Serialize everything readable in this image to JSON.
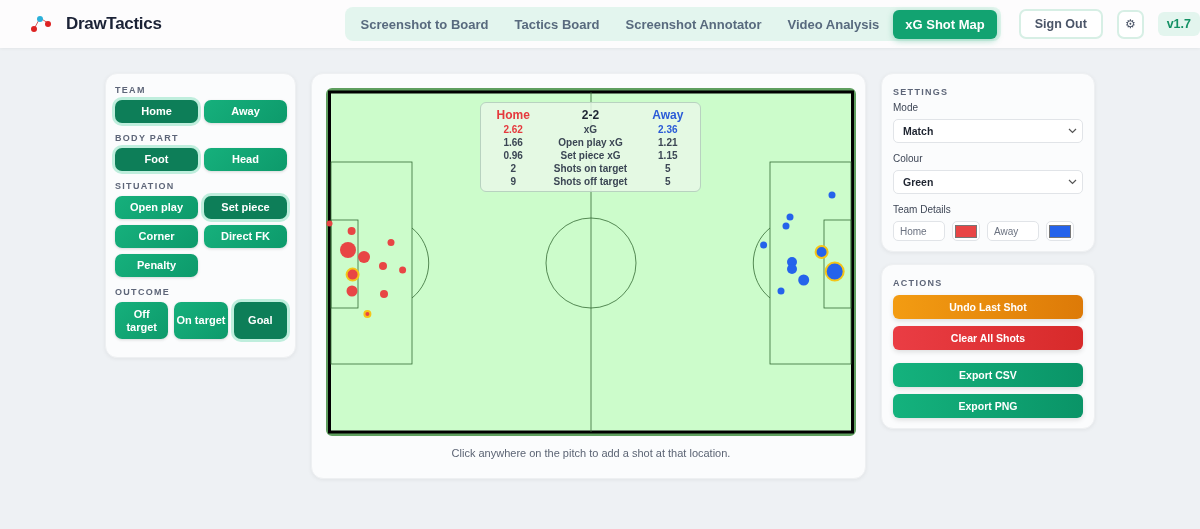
{
  "header": {
    "brand": "DrawTactics",
    "nav": [
      {
        "label": "Screenshot to Board",
        "selected": false
      },
      {
        "label": "Tactics Board",
        "selected": false
      },
      {
        "label": "Screenshot Annotator",
        "selected": false
      },
      {
        "label": "Video Analysis",
        "selected": false
      },
      {
        "label": "xG Shot Map",
        "selected": true
      }
    ],
    "sign_out": "Sign Out",
    "settings_glyph": "⚙",
    "version": "v1.7"
  },
  "controls": [
    {
      "title": "TEAM",
      "options": [
        {
          "label": "Home",
          "selected": true
        },
        {
          "label": "Away",
          "selected": false
        }
      ]
    },
    {
      "title": "BODY PART",
      "options": [
        {
          "label": "Foot",
          "selected": true
        },
        {
          "label": "Head",
          "selected": false
        }
      ]
    },
    {
      "title": "SITUATION",
      "options": [
        {
          "label": "Open play",
          "selected": false
        },
        {
          "label": "Set piece",
          "selected": true
        },
        {
          "label": "Corner",
          "selected": false
        },
        {
          "label": "Direct FK",
          "selected": false
        },
        {
          "label": "Penalty",
          "selected": false
        }
      ]
    },
    {
      "title": "OUTCOME",
      "options": [
        {
          "label": "Off target",
          "selected": false
        },
        {
          "label": "On target",
          "selected": false
        },
        {
          "label": "Goal",
          "selected": true
        }
      ]
    }
  ],
  "summary": {
    "home": "Home",
    "score": "2-2",
    "away": "Away",
    "rows": [
      {
        "home": "2.62",
        "label": "xG",
        "away": "2.36",
        "kind": "highlight"
      },
      {
        "home": "1.66",
        "label": "Open play xG",
        "away": "1.21",
        "kind": "plain"
      },
      {
        "home": "0.96",
        "label": "Set piece xG",
        "away": "1.15",
        "kind": "plain"
      },
      {
        "home": "2",
        "label": "Shots on target",
        "away": "5",
        "kind": "plain"
      },
      {
        "home": "9",
        "label": "Shots off target",
        "away": "5",
        "kind": "plain"
      }
    ]
  },
  "hint": "Click anywhere on the pitch to add a shot at that location.",
  "settings": {
    "title": "SETTINGS",
    "mode_label": "Mode",
    "mode": "Match",
    "colour_label": "Colour",
    "colour": "Green",
    "team_label": "Team Details",
    "teams": [
      {
        "placeholder": "Home",
        "color": "#e84545"
      },
      {
        "placeholder": "Away",
        "color": "#2563eb"
      }
    ]
  },
  "actions": {
    "title": "ACTIONS",
    "buttons": [
      {
        "label": "Undo Last Shot",
        "kind": "warning"
      },
      {
        "label": "Clear All Shots",
        "kind": "danger"
      },
      {
        "label": "Export CSV",
        "kind": "primary"
      },
      {
        "label": "Export PNG",
        "kind": "primary"
      }
    ]
  }
}
